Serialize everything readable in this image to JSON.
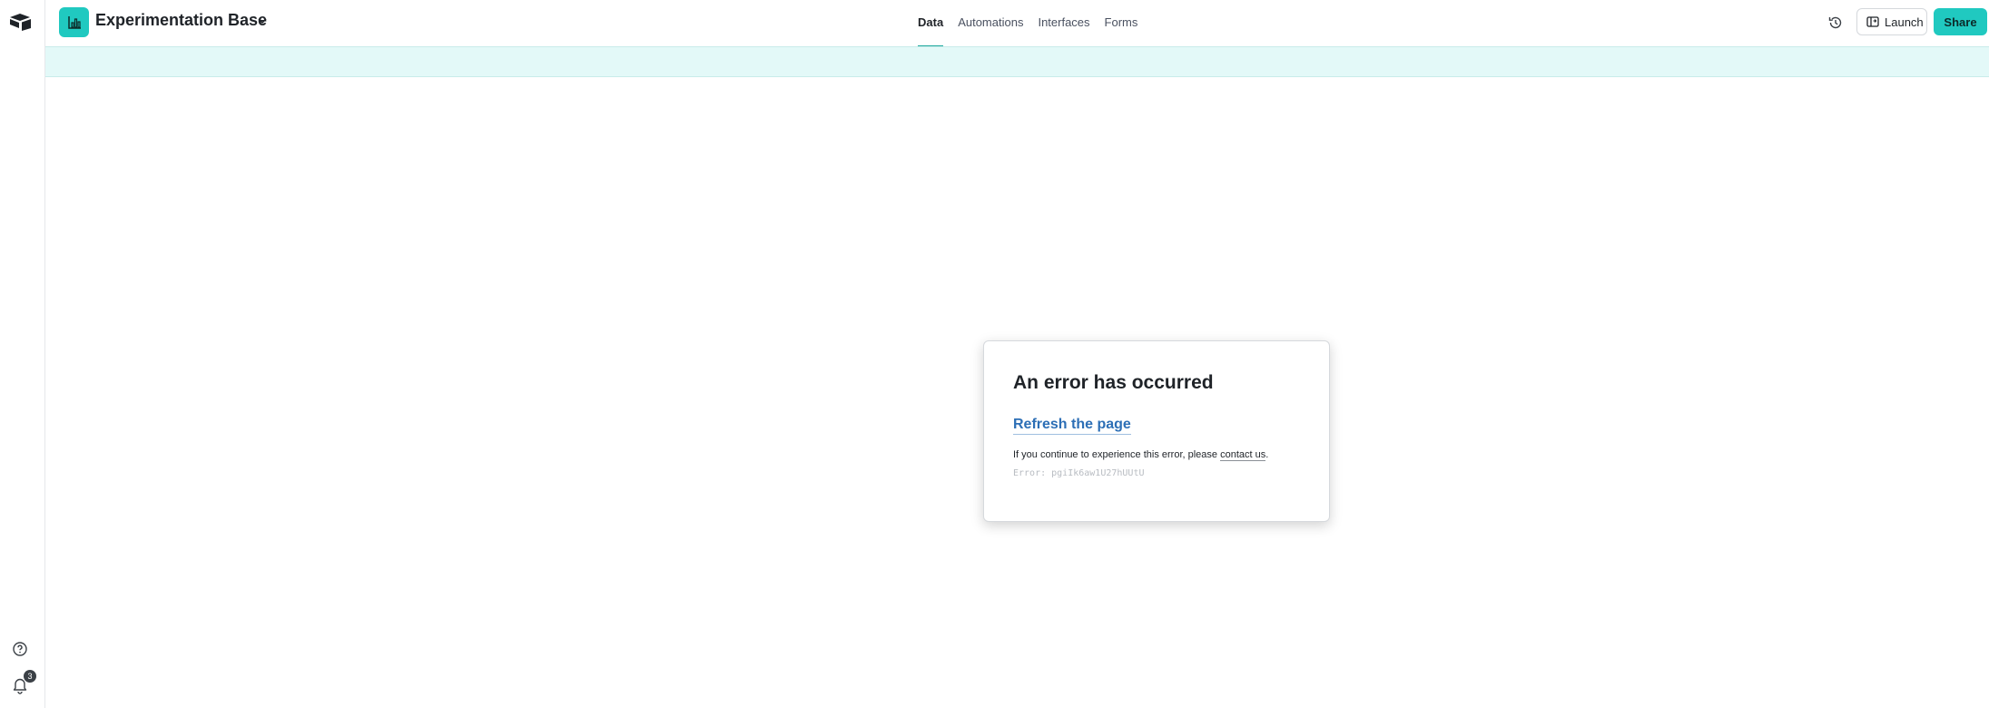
{
  "header": {
    "base_title": "Experimentation Base",
    "tabs": [
      {
        "label": "Data",
        "active": true
      },
      {
        "label": "Automations",
        "active": false
      },
      {
        "label": "Interfaces",
        "active": false
      },
      {
        "label": "Forms",
        "active": false
      }
    ],
    "launch_label": "Launch",
    "share_label": "Share"
  },
  "sidebar": {
    "notification_count": "3"
  },
  "error": {
    "title": "An error has occurred",
    "refresh_label": "Refresh the page",
    "message_prefix": "If you continue to experience this error, please ",
    "contact_label": "contact us",
    "message_suffix": ".",
    "code": "Error: pgiIk6aw1U27hUUtU"
  },
  "colors": {
    "accent": "#20c9c0",
    "link": "#2d6fb6",
    "band": "#e3f9f8"
  },
  "icons": [
    "airtable-logo-icon",
    "help-icon",
    "bell-icon",
    "chart-icon",
    "chevron-down-icon",
    "history-icon",
    "launch-icon"
  ]
}
